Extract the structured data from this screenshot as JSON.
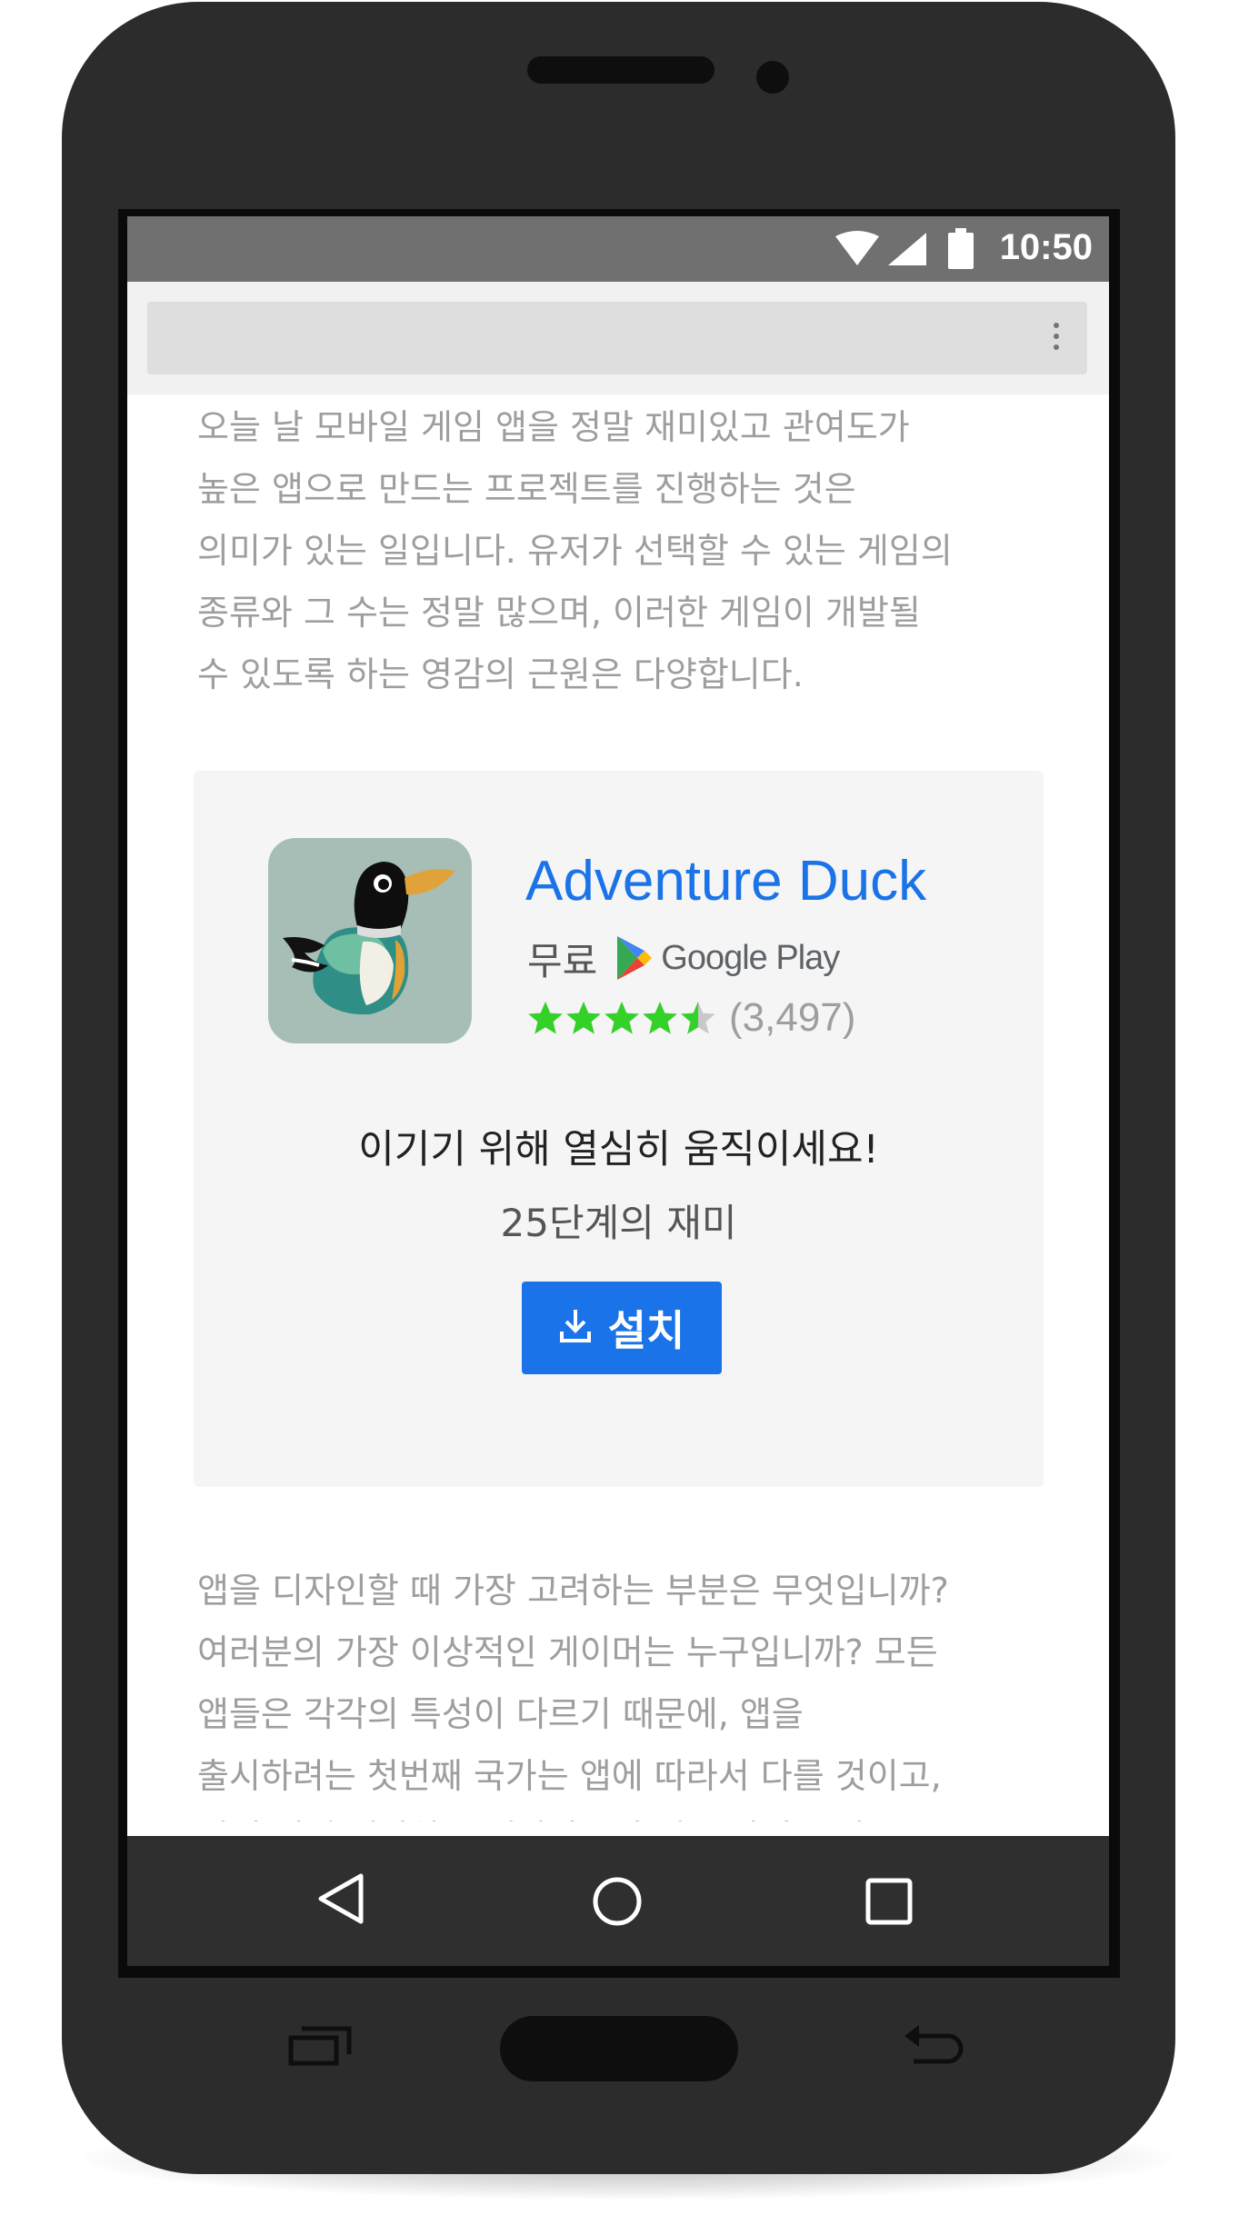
{
  "status_bar": {
    "time": "10:50",
    "icons": [
      "wifi-icon",
      "signal-icon",
      "battery-icon"
    ]
  },
  "browser": {
    "url": "",
    "menu_icon": "more-vert-icon"
  },
  "article": {
    "paragraph_1": "오늘 날 모바일 게임 앱을 정말 재미있고 관여도가\n높은 앱으로 만드는 프로젝트를 진행하는 것은\n의미가 있는 일입니다. 유저가 선택할 수 있는 게임의\n종류와 그 수는 정말 많으며, 이러한 게임이 개발될\n수 있도록 하는 영감의 근원은 다양합니다.",
    "paragraph_2": "앱을 디자인할 때 가장 고려하는 부분은 무엇입니까?\n여러분의 가장 이상적인 게이머는 누구입니까? 모든\n앱들은 각각의 특성이 다르기 때문에, 앱을\n출시하려는 첫번째 국가는 앱에 따라서 다를 것이고,\n이에 대해 생각하는 개발자들의 접근 방식도 다를"
  },
  "ad": {
    "app_name": "Adventure Duck",
    "price": "무료",
    "store": "Google Play",
    "rating": 4.5,
    "rating_max": 5,
    "rating_count": "(3,497)",
    "tagline": "이기기 위해 열심히 움직이세요!",
    "subline": "25단계의 재미",
    "install_label": "설치",
    "colors": {
      "accent": "#1a73e8",
      "star": "#34d129",
      "card_bg": "#f5f5f5"
    }
  },
  "nav_bar": {
    "buttons": [
      "back-icon",
      "home-icon",
      "recents-icon"
    ]
  }
}
